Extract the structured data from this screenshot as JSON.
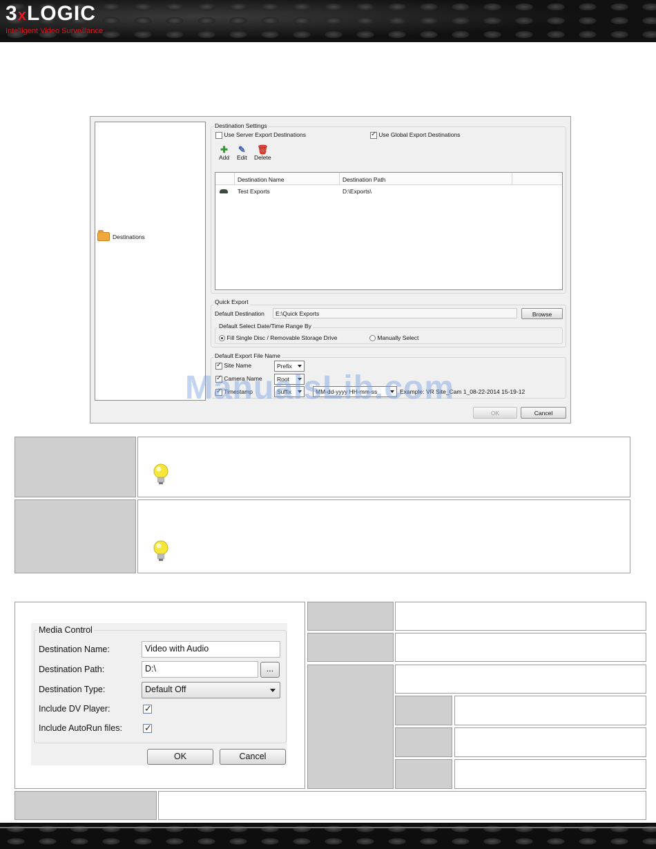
{
  "header": {
    "logo_main_a": "3",
    "logo_main_x": "x",
    "logo_main_b": "LOGIC",
    "logo_tagline": "Intelligent Video Surveillance"
  },
  "watermark": "ManualsLib.com",
  "dialog": {
    "tree_item": "Destinations",
    "destination_settings": {
      "title": "Destination Settings",
      "use_server_label": "Use Server Export Destinations",
      "use_server_checked": false,
      "use_global_label": "Use Global Export Destinations",
      "use_global_checked": true,
      "toolbar": {
        "add": "Add",
        "edit": "Edit",
        "delete": "Delete"
      },
      "columns": [
        "Destination Name",
        "Destination Path"
      ],
      "rows": [
        {
          "name": "Test Exports",
          "path": "D:\\Exports\\"
        }
      ]
    },
    "quick_export": {
      "title": "Quick Export",
      "default_destination_label": "Default Destination",
      "default_destination_value": "E:\\Quick Exports",
      "browse_button": "Browse",
      "range_title": "Default Select Date/Time Range By",
      "option_fill": "Fill Single Disc / Removable Storage Drive",
      "option_manual": "Manually Select"
    },
    "file_name": {
      "title": "Default Export File Name",
      "site_name_label": "Site Name",
      "site_name_select": "Prefix",
      "camera_name_label": "Camera Name",
      "camera_name_select": "Root",
      "timestamp_label": "Timestamp",
      "timestamp_select": "Suffix",
      "timestamp_format": "MM-dd-yyyy HH-mm-ss",
      "example_label": "Example:",
      "example_value": "VR Site_Cam 1_08-22-2014 15-19-12"
    },
    "ok_button": "OK",
    "cancel_button": "Cancel"
  },
  "media_control": {
    "title": "Media Control",
    "destination_name_label": "Destination Name:",
    "destination_name_value": "Video with Audio",
    "destination_path_label": "Destination Path:",
    "destination_path_value": "D:\\",
    "browse_button": "...",
    "destination_type_label": "Destination Type:",
    "destination_type_value": "Default Off",
    "include_dv_label": "Include DV Player:",
    "include_autorun_label": "Include AutoRun files:",
    "ok_button": "OK",
    "cancel_button": "Cancel"
  },
  "icons": {
    "bulb": "lightbulb-icon",
    "add": "plus-icon",
    "edit": "edit-icon",
    "delete": "trash-icon",
    "folder": "folder-icon",
    "drive": "drive-icon"
  },
  "colors": {
    "brand_red": "#e31b23",
    "table_grey": "#cfcfcf"
  }
}
